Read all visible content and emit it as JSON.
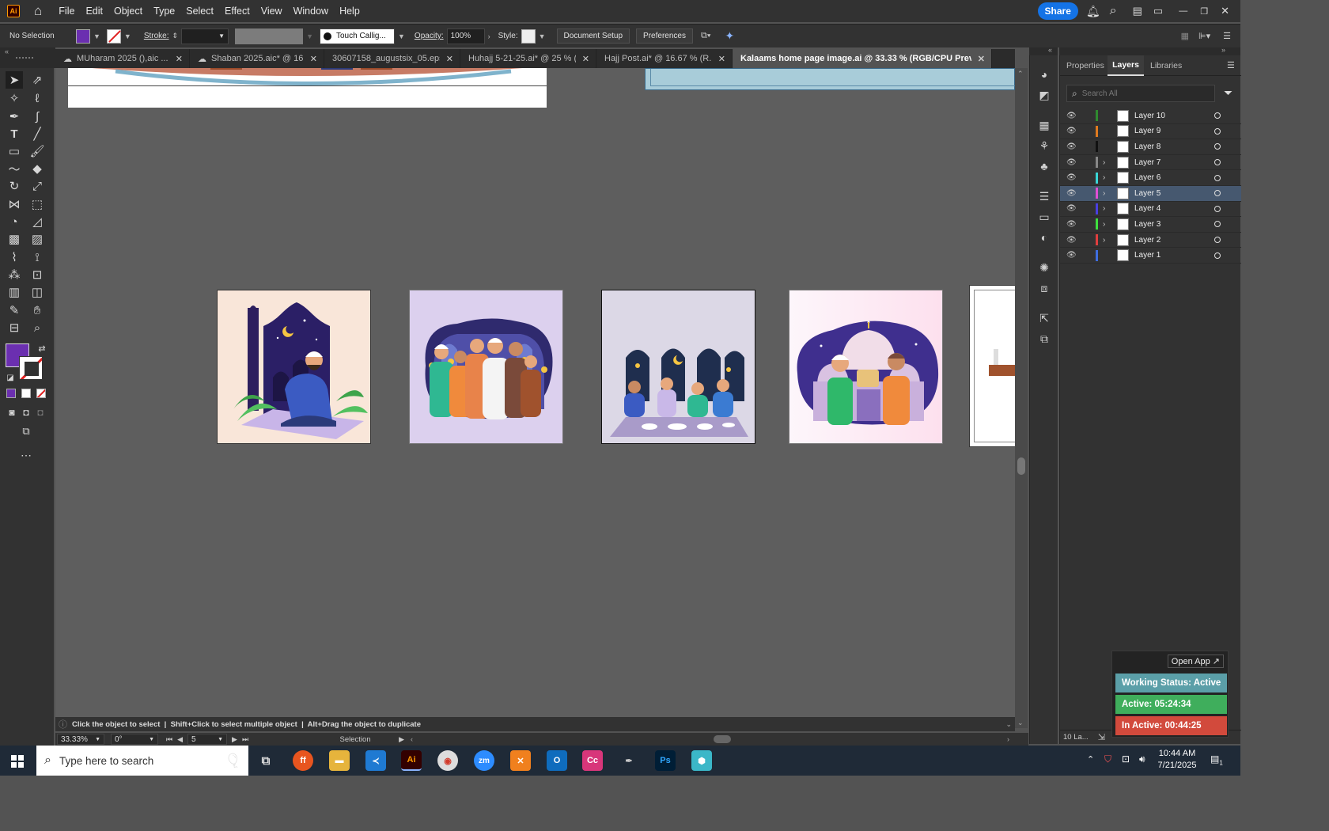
{
  "menubar": {
    "app_badge": "Ai",
    "items": [
      "File",
      "Edit",
      "Object",
      "Type",
      "Select",
      "Effect",
      "View",
      "Window",
      "Help"
    ],
    "share_label": "Share"
  },
  "control": {
    "selection": "No Selection",
    "stroke_label": "Stroke:",
    "brush": "Touch Callig...",
    "opacity_label": "Opacity:",
    "opacity_value": "100%",
    "style_label": "Style:",
    "doc_setup": "Document Setup",
    "preferences": "Preferences",
    "fill_color": "#6b2fb0"
  },
  "tabs": [
    {
      "label": "MUharam 2025 (),aic ...",
      "cloud": true,
      "active": false
    },
    {
      "label": "Shaban 2025.aic* @ 16...",
      "cloud": true,
      "active": false
    },
    {
      "label": "30607158_augustsix_05.eps*",
      "cloud": false,
      "active": false
    },
    {
      "label": "Huhajj 5-21-25.ai* @ 25 % (...",
      "cloud": false,
      "active": false
    },
    {
      "label": "Hajj Post.ai* @ 16.67 % (R...",
      "cloud": false,
      "active": false
    },
    {
      "label": "Kalaams home page image.ai @ 33.33 % (RGB/CPU Preview)",
      "cloud": false,
      "active": true
    }
  ],
  "panel": {
    "tabs": [
      "Properties",
      "Layers",
      "Libraries"
    ],
    "active_tab": "Layers",
    "search_placeholder": "Search All",
    "layers": [
      {
        "name": "Layer 10",
        "color": "#2f8a2f",
        "expandable": false,
        "selected": false
      },
      {
        "name": "Layer 9",
        "color": "#e07a1f",
        "expandable": false,
        "selected": false
      },
      {
        "name": "Layer 8",
        "color": "#111111",
        "expandable": false,
        "selected": false
      },
      {
        "name": "Layer 7",
        "color": "#888888",
        "expandable": true,
        "selected": false
      },
      {
        "name": "Layer 6",
        "color": "#3ad6d6",
        "expandable": true,
        "selected": false
      },
      {
        "name": "Layer 5",
        "color": "#e04fd6",
        "expandable": true,
        "selected": true
      },
      {
        "name": "Layer 4",
        "color": "#4a3fe0",
        "expandable": true,
        "selected": false
      },
      {
        "name": "Layer 3",
        "color": "#3ee03e",
        "expandable": true,
        "selected": false
      },
      {
        "name": "Layer 2",
        "color": "#e03e3e",
        "expandable": true,
        "selected": false
      },
      {
        "name": "Layer 1",
        "color": "#3e6ee0",
        "expandable": false,
        "selected": false
      }
    ],
    "layer_count": "10 La..."
  },
  "status": {
    "hint": "Click the object to select  |  Shift+Click to select multiple object  |  Alt+Drag the object to duplicate",
    "zoom": "33.33%",
    "rotation": "0°",
    "artboard": "5",
    "tool": "Selection"
  },
  "widget": {
    "open_app": "Open App ↗",
    "working": "Working Status: Active",
    "active": "Active: 05:24:34",
    "inactive": "In Active: 00:44:25"
  },
  "taskbar": {
    "search_placeholder": "Type here to search",
    "time": "10:44 AM",
    "date": "7/21/2025",
    "notif_count": "1"
  }
}
